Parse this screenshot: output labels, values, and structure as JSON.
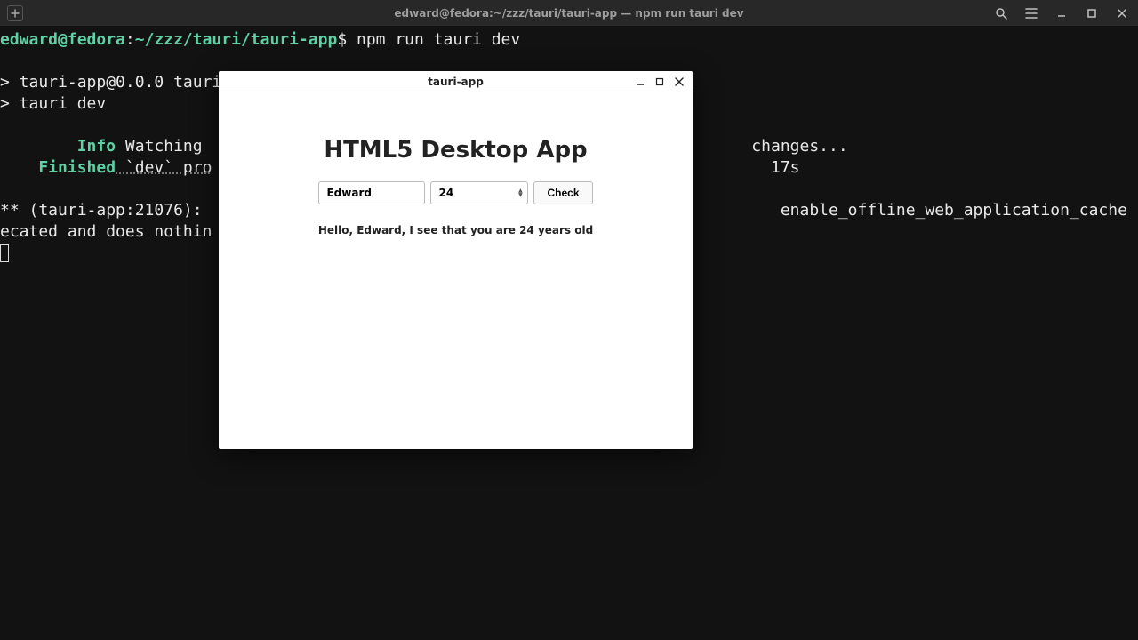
{
  "terminal": {
    "title": "edward@fedora:~/zzz/tauri/tauri-app — npm run tauri dev",
    "prompt_user": "edward@fedora",
    "prompt_sep": ":",
    "prompt_path": "~/zzz/tauri/tauri-app",
    "prompt_dollar": "$ ",
    "command": "npm run tauri dev",
    "line_pkg": "> tauri-app@0.0.0 tauri",
    "line_dev": "> tauri dev",
    "info_label": "Info",
    "info_rest_left": " Watching ",
    "info_rest_right": " changes...",
    "finished_label": "Finished",
    "finished_rest_left": " `dev` pro",
    "finished_rest_right": "17s",
    "warn_left": "** (tauri-app:21076): ",
    "warn_right": "enable_offline_web_application_cache is depr",
    "warn_line2": "ecated and does nothin"
  },
  "app": {
    "window_title": "tauri-app",
    "heading": "HTML5 Desktop App",
    "name_value": "Edward",
    "age_value": "24",
    "button_label": "Check",
    "greeting": "Hello, Edward, I see that you are 24 years old"
  }
}
